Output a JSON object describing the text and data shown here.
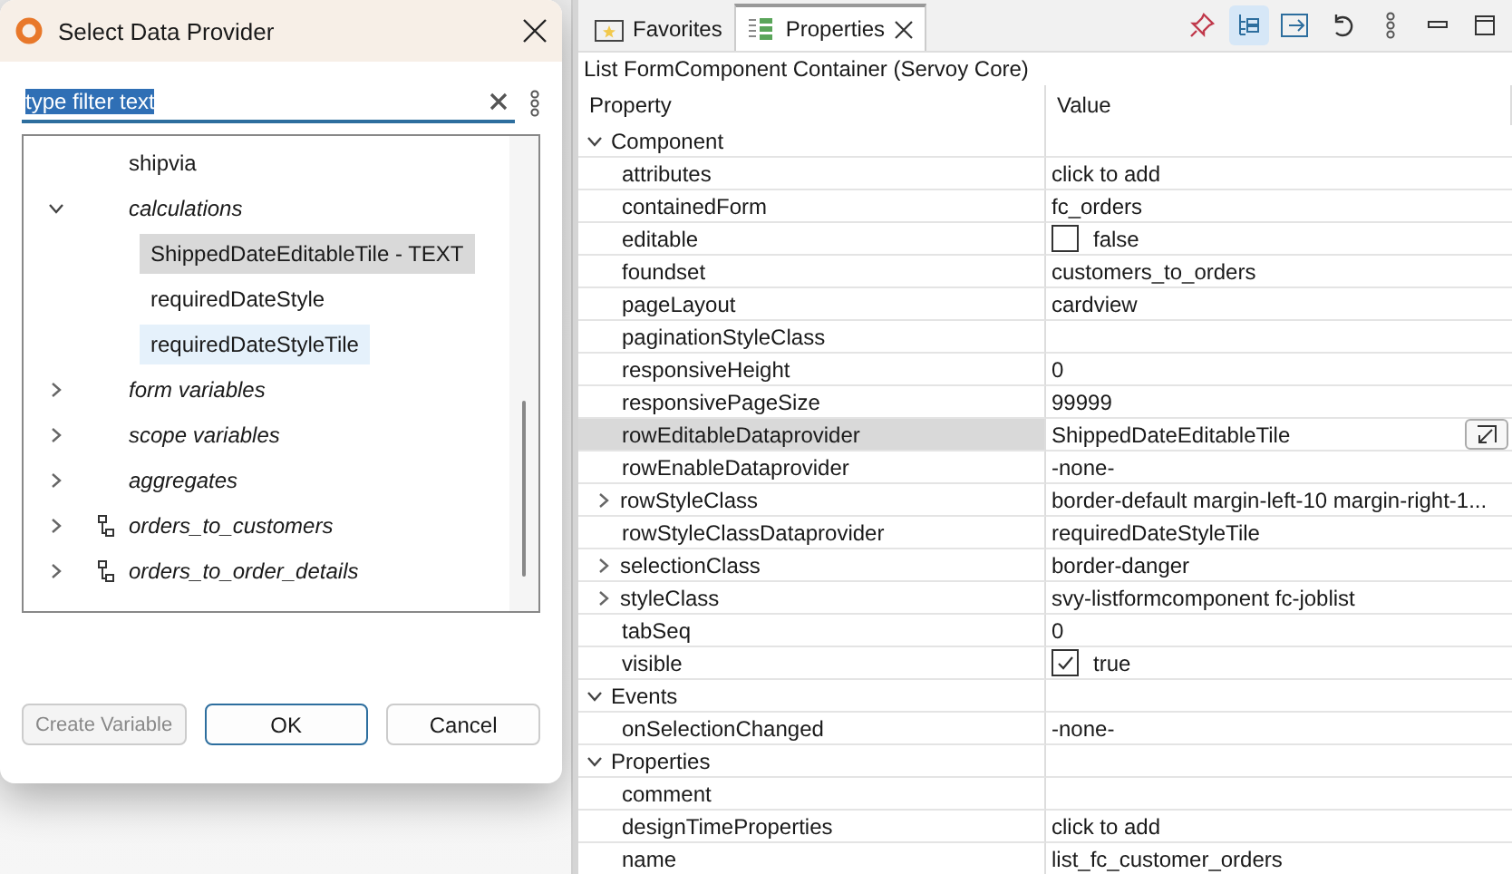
{
  "dialog": {
    "title": "Select Data Provider",
    "filter": {
      "value": "type filter text",
      "selected": true
    },
    "tree": [
      {
        "label": "shipvia",
        "kind": "field",
        "selected": false,
        "hovered": false
      },
      {
        "label": "calculations",
        "kind": "group",
        "selected": false,
        "hovered": false,
        "expanded": true,
        "children": [
          {
            "label": "ShippedDateEditableTile - TEXT",
            "kind": "field",
            "selected": true,
            "hovered": false
          },
          {
            "label": "requiredDateStyle",
            "kind": "field",
            "selected": false,
            "hovered": false
          },
          {
            "label": "requiredDateStyleTile",
            "kind": "field",
            "selected": false,
            "hovered": true
          }
        ]
      },
      {
        "label": "form variables",
        "kind": "group",
        "selected": false,
        "hovered": false,
        "expanded": false
      },
      {
        "label": "scope variables",
        "kind": "group",
        "selected": false,
        "hovered": false,
        "expanded": false
      },
      {
        "label": "aggregates",
        "kind": "group",
        "selected": false,
        "hovered": false,
        "expanded": false
      },
      {
        "label": "orders_to_customers",
        "kind": "relation",
        "selected": false,
        "hovered": false,
        "expanded": false
      },
      {
        "label": "orders_to_order_details",
        "kind": "relation",
        "selected": false,
        "hovered": false,
        "expanded": false
      }
    ],
    "buttons": [
      {
        "label": "Create Variable",
        "disabled": true,
        "default": false
      },
      {
        "label": "OK",
        "disabled": false,
        "default": true
      },
      {
        "label": "Cancel",
        "disabled": false,
        "default": false
      }
    ]
  },
  "panel": {
    "tabs": [
      {
        "label": "Favorites",
        "selected": false
      },
      {
        "label": "Properties",
        "selected": true
      }
    ],
    "toolbar": [
      {
        "kind": "pin",
        "on": false
      },
      {
        "kind": "tree",
        "on": true
      },
      {
        "kind": "link",
        "on": false
      },
      {
        "kind": "undo",
        "on": false
      },
      {
        "kind": "more",
        "on": false
      },
      {
        "kind": "minimize",
        "on": false
      },
      {
        "kind": "maximize",
        "on": false
      }
    ],
    "title": "List FormComponent Container (Servoy Core)",
    "columns": [
      "Property",
      "Value"
    ],
    "sections": [
      {
        "label": "Component",
        "expanded": true,
        "rows": [
          {
            "name": "attributes",
            "value": "click to add",
            "kind": "text",
            "expandable": false,
            "selected": false
          },
          {
            "name": "containedForm",
            "value": "fc_orders",
            "kind": "text",
            "expandable": false,
            "selected": false
          },
          {
            "name": "editable",
            "value": "false",
            "kind": "checkbox",
            "checked": false,
            "expandable": false,
            "selected": false
          },
          {
            "name": "foundset",
            "value": "customers_to_orders",
            "kind": "text",
            "expandable": false,
            "selected": false
          },
          {
            "name": "pageLayout",
            "value": "cardview",
            "kind": "text",
            "expandable": false,
            "selected": false
          },
          {
            "name": "paginationStyleClass",
            "kind": "text",
            "expandable": false,
            "selected": false
          },
          {
            "name": "responsiveHeight",
            "value": "0",
            "kind": "text",
            "expandable": false,
            "selected": false
          },
          {
            "name": "responsivePageSize",
            "value": "99999",
            "kind": "text",
            "expandable": false,
            "selected": false
          },
          {
            "name": "rowEditableDataprovider",
            "value": "ShippedDateEditableTile",
            "kind": "picker",
            "expandable": false,
            "selected": true
          },
          {
            "name": "rowEnableDataprovider",
            "value": "-none-",
            "kind": "text",
            "expandable": false,
            "selected": false
          },
          {
            "name": "rowStyleClass",
            "value": "border-default margin-left-10 margin-right-1...",
            "kind": "text",
            "expandable": true,
            "selected": false
          },
          {
            "name": "rowStyleClassDataprovider",
            "value": "requiredDateStyleTile",
            "kind": "text",
            "expandable": false,
            "selected": false
          },
          {
            "name": "selectionClass",
            "value": "border-danger",
            "kind": "text",
            "expandable": true,
            "selected": false
          },
          {
            "name": "styleClass",
            "value": "svy-listformcomponent fc-joblist",
            "kind": "text",
            "expandable": true,
            "selected": false
          },
          {
            "name": "tabSeq",
            "value": "0",
            "kind": "text",
            "expandable": false,
            "selected": false
          },
          {
            "name": "visible",
            "value": "true",
            "kind": "checkbox",
            "checked": true,
            "expandable": false,
            "selected": false
          }
        ]
      },
      {
        "label": "Events",
        "expanded": true,
        "rows": [
          {
            "name": "onSelectionChanged",
            "value": "-none-",
            "kind": "text",
            "expandable": false,
            "selected": false
          }
        ]
      },
      {
        "label": "Properties",
        "expanded": true,
        "rows": [
          {
            "name": "comment",
            "kind": "text",
            "expandable": false,
            "selected": false
          },
          {
            "name": "designTimeProperties",
            "value": "click to add",
            "kind": "text",
            "expandable": false,
            "selected": false
          },
          {
            "name": "name",
            "value": "list_fc_customer_orders",
            "kind": "text",
            "expandable": false,
            "selected": false
          }
        ]
      }
    ]
  }
}
